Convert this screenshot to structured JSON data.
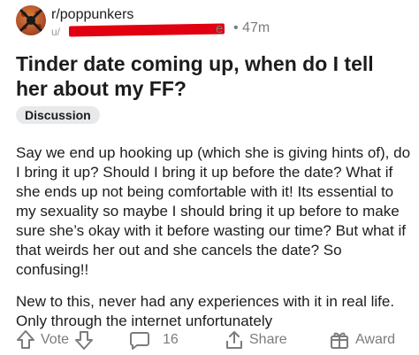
{
  "post": {
    "subreddit": "r/poppunkers",
    "username_visible_tail": "e",
    "age": "47m",
    "title": "Tinder date coming up, when do I tell her about my FF?",
    "flair": "Discussion",
    "body_paragraphs": [
      "Say we end up hooking up (which she is giving hints of), do I bring it up? Should I bring it up before the date? What if she ends up not being comfortable with it! Its essential to my sexuality so maybe I should bring it up before to make sure she’s okay with it before wasting our time? But what if that weirds her out and she cancels the date? So confusing!!",
      "New to this, never had any experiences with it in real life. Only through the internet unfortunately"
    ]
  },
  "actions": {
    "vote_label": "Vote",
    "comments_count": "16",
    "share_label": "Share",
    "award_label": "Award"
  },
  "icons": {
    "avatar": "subreddit-avatar-icon",
    "upvote": "upvote-arrow-icon",
    "downvote": "downvote-arrow-icon",
    "comment": "comment-bubble-icon",
    "share": "share-icon",
    "award": "award-gift-icon"
  },
  "colors": {
    "redaction": "#e0000f",
    "muted_text": "#7c7c7c",
    "flair_bg": "#e8e9eb"
  }
}
